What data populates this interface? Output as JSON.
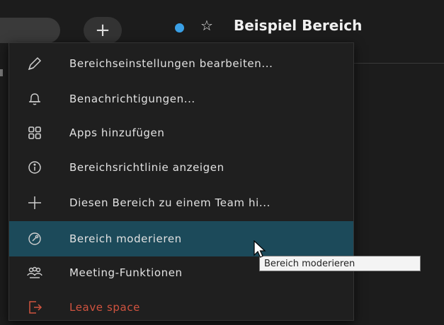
{
  "header": {
    "new_button_icon": "plus-icon",
    "status_color": "#3aa0e6",
    "favorite_icon": "star-icon",
    "space_title": "Beispiel Bereich"
  },
  "menu": {
    "items": [
      {
        "icon": "pencil-icon",
        "label": "Bereichseinstellungen bearbeiten..."
      },
      {
        "icon": "bell-icon",
        "label": "Benachrichtigungen..."
      },
      {
        "icon": "apps-grid-icon",
        "label": "Apps hinzufügen"
      },
      {
        "icon": "info-icon",
        "label": "Bereichsrichtlinie anzeigen"
      },
      {
        "icon": "plus-icon",
        "label": "Diesen Bereich zu einem Team hi..."
      },
      {
        "icon": "moderate-icon",
        "label": "Bereich moderieren",
        "highlighted": true
      },
      {
        "icon": "people-icon",
        "label": "Meeting-Funktionen"
      },
      {
        "icon": "leave-icon",
        "label": "Leave space",
        "danger": true
      }
    ]
  },
  "tooltip": {
    "text": "Bereich moderieren"
  },
  "colors": {
    "accent": "#1c4a5a",
    "danger": "#d0533f",
    "background": "#1c1c1c"
  }
}
